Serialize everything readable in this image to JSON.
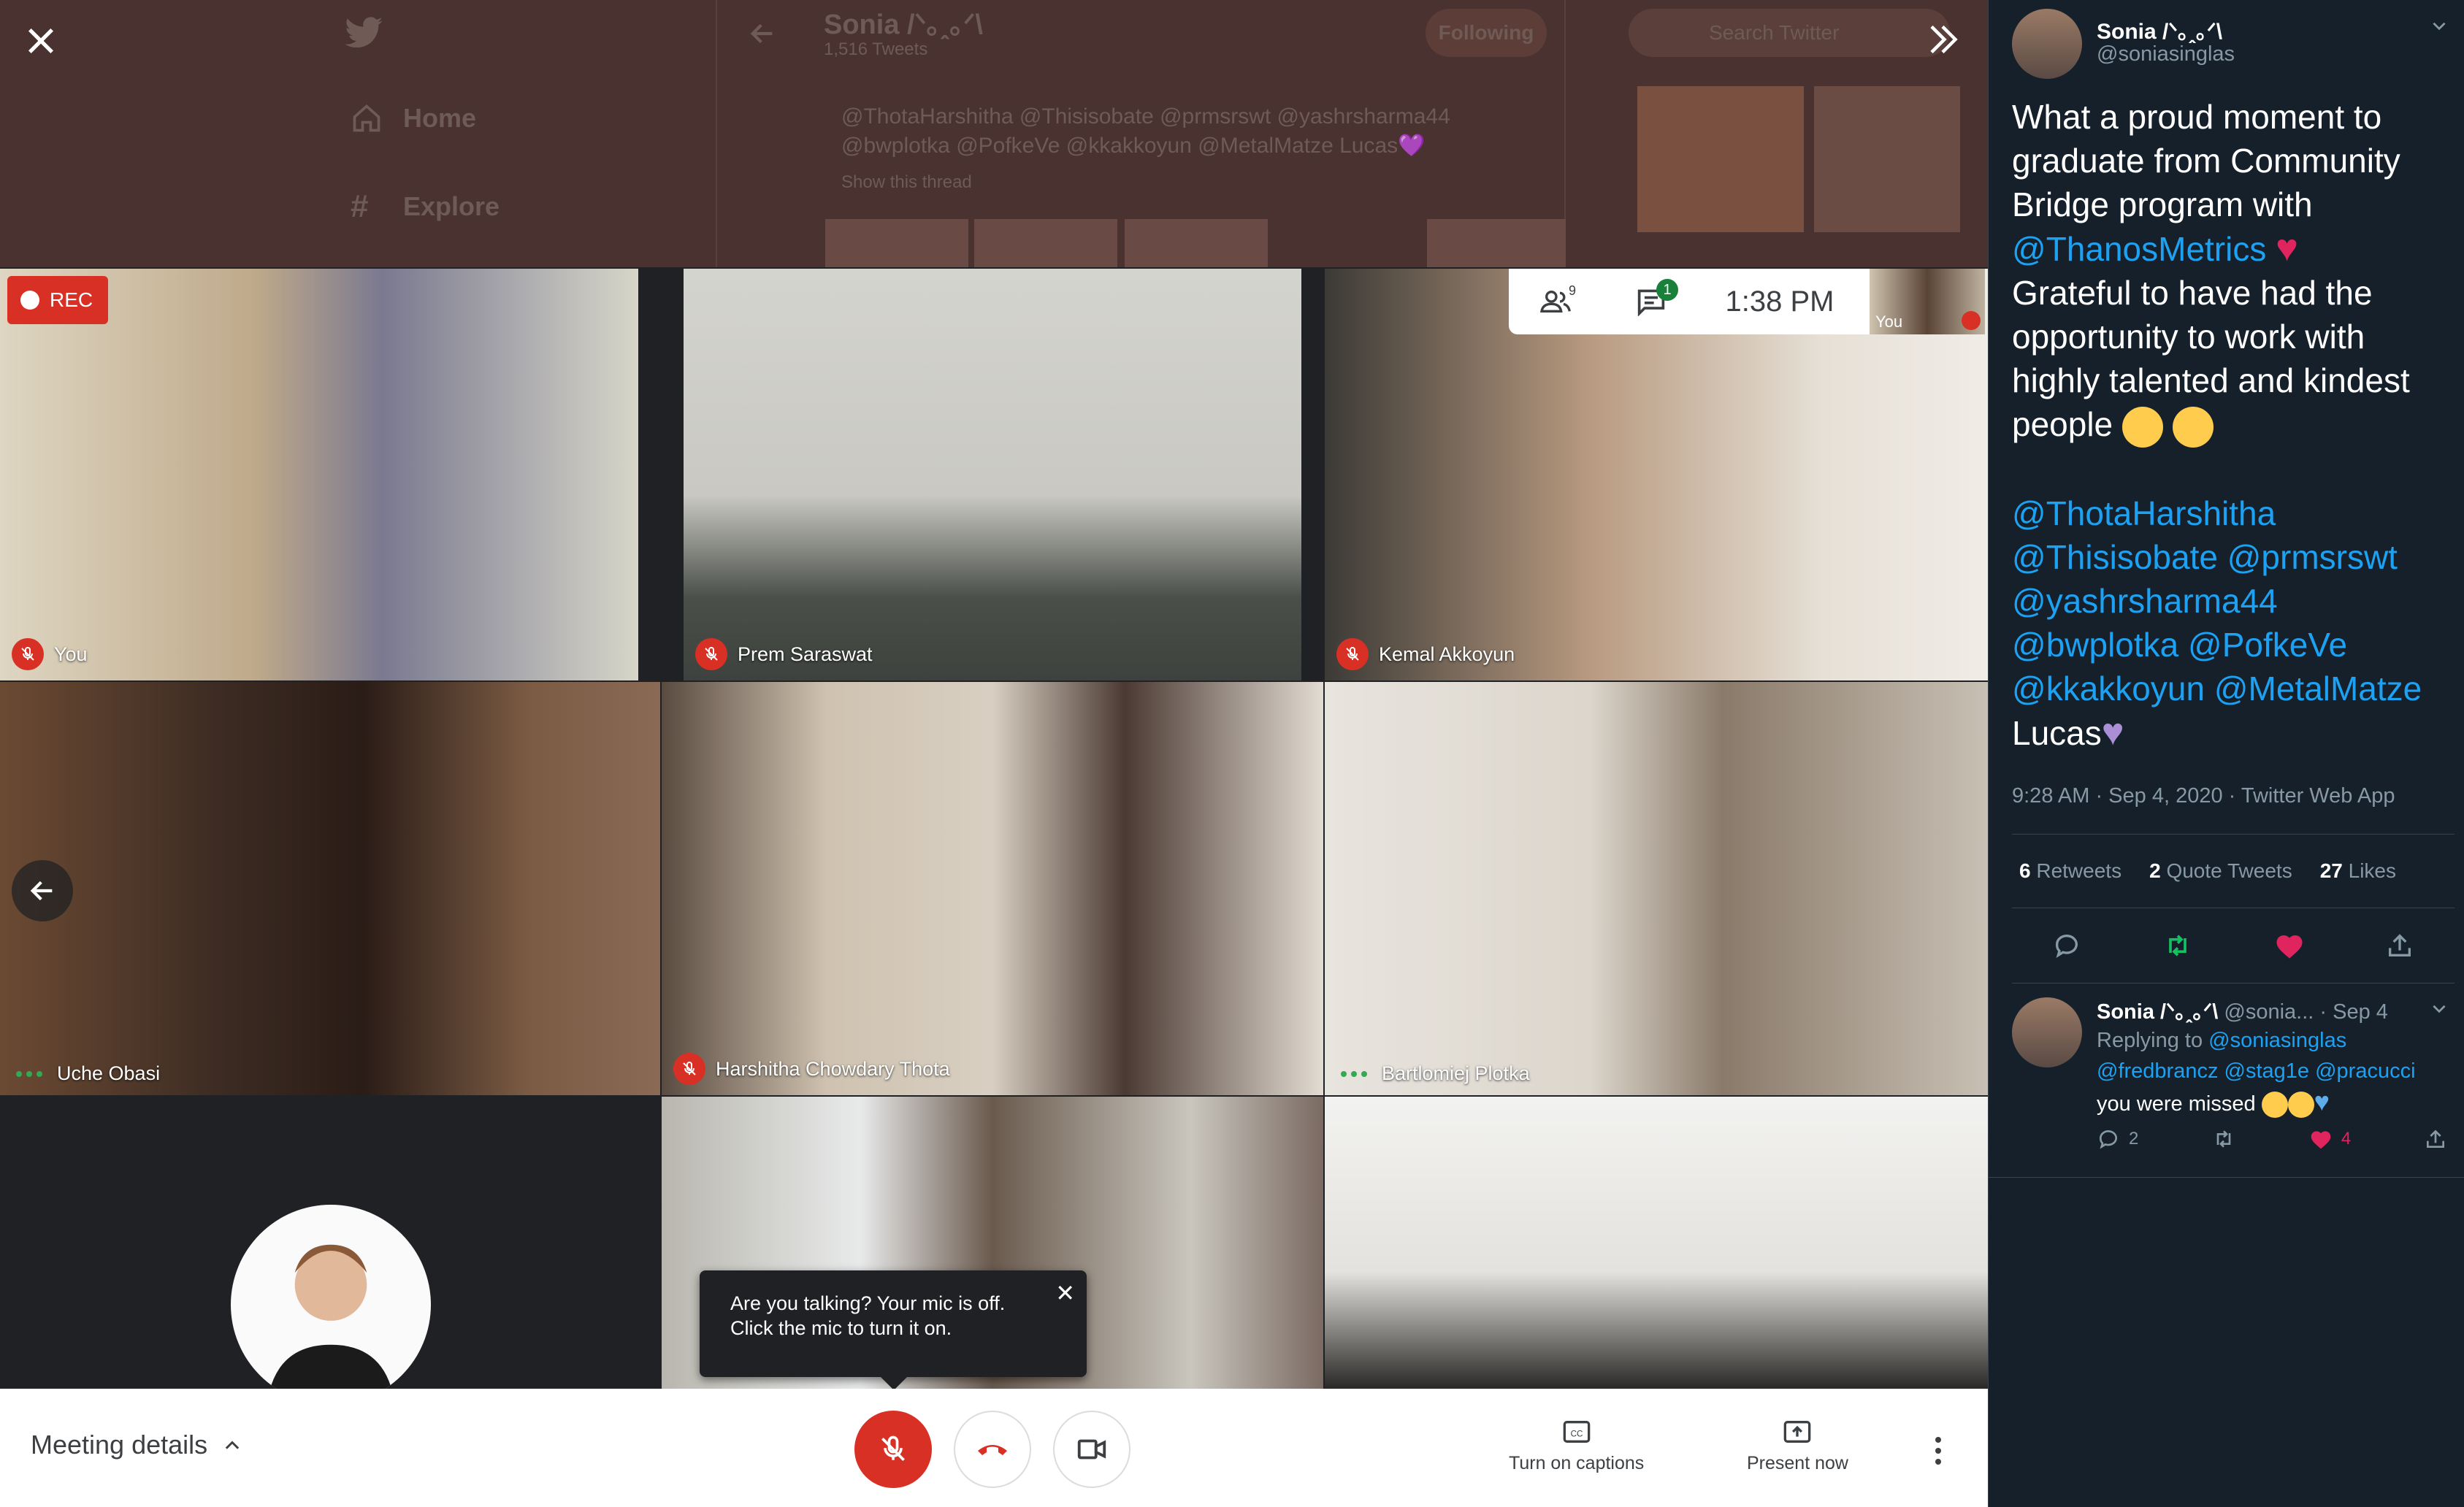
{
  "background_twitter": {
    "home_label": "Home",
    "explore_label": "Explore",
    "profile_name": "Sonia /ᐠ｡ꞈ｡ᐟ\\",
    "tweet_count": "1,516 Tweets",
    "following_label": "Following",
    "search_placeholder": "Search Twitter",
    "mentions_line1": "@ThotaHarshitha @Thisisobate @prmsrswt @yashrsharma44",
    "mentions_line2": "@bwplotka @PofkeVe @kkakkoyun @MetalMatze Lucas💜",
    "show_thread": "Show this thread"
  },
  "meet": {
    "rec_label": "REC",
    "participants_count": "9",
    "chat_badge": "1",
    "time": "1:38 PM",
    "self_view_label": "You",
    "tiles": [
      {
        "name": "You",
        "status": "muted"
      },
      {
        "name": "Prem Saraswat",
        "status": "muted"
      },
      {
        "name": "Kemal Akkoyun",
        "status": "muted"
      },
      {
        "name": "Uche Obasi",
        "status": "speaking"
      },
      {
        "name": "Harshitha Chowdary Thota",
        "status": "muted"
      },
      {
        "name": "Bartlomiej Plotka",
        "status": "speaking"
      }
    ],
    "tooltip_text": "Are you talking? Your mic is off. Click the mic to turn it on.",
    "meeting_details_label": "Meeting details",
    "captions_label": "Turn on captions",
    "present_label": "Present now"
  },
  "tweet": {
    "display_name": "Sonia /ᐠ｡ꞈ｡ᐟ\\",
    "handle": "@soniasinglas",
    "text_part1": "What a proud moment to graduate from Community Bridge program with",
    "mention_thanos": "@ThanosMetrics",
    "text_part2": "Grateful to have had the opportunity to work with highly talented and kindest people",
    "mentions": [
      "@ThotaHarshitha",
      "@Thisisobate",
      "@prmsrswt",
      "@yashrsharma44",
      "@bwplotka",
      "@PofkeVe",
      "@kkakkoyun",
      "@MetalMatze"
    ],
    "text_end": "Lucas",
    "meta": "9:28 AM · Sep 4, 2020 · Twitter Web App",
    "retweets_count": "6",
    "retweets_label": "Retweets",
    "quotes_count": "2",
    "quotes_label": "Quote Tweets",
    "likes_count": "27",
    "likes_label": "Likes"
  },
  "reply": {
    "display_name": "Sonia /ᐠ｡ꞈ｡ᐟ\\",
    "handle_date": "@sonia... · Sep 4",
    "replying_to_label": "Replying to",
    "replying_to": [
      "@soniasinglas",
      "@fredbrancz",
      "@stag1e",
      "@pracucci"
    ],
    "text": "you were missed",
    "reply_count": "2",
    "like_count": "4"
  },
  "colors": {
    "meet_red": "#d93025",
    "twitter_blue": "#1da1f2",
    "twitter_bg": "#15202b",
    "like_pink": "#e0245e",
    "retweet_green": "#17bf63"
  }
}
